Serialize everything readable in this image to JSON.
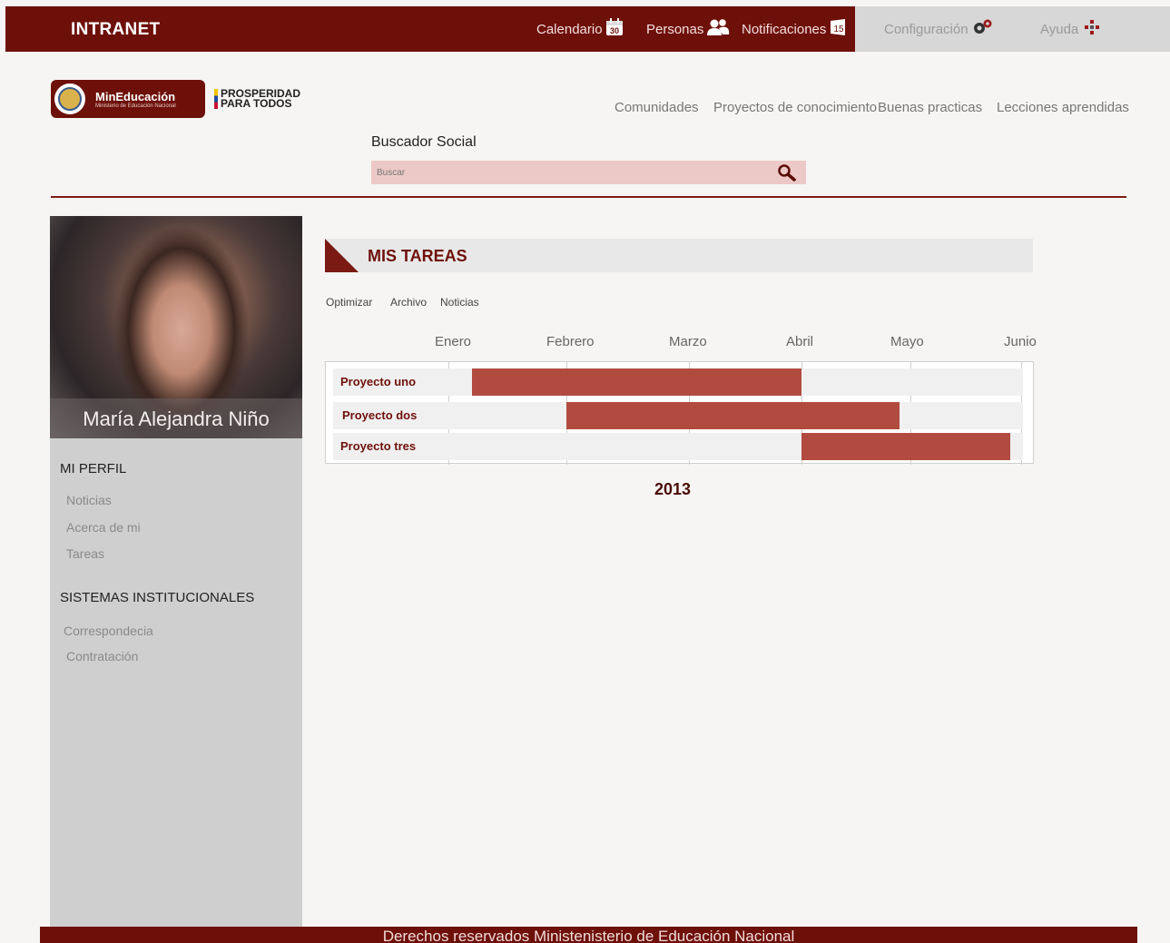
{
  "topbar": {
    "brand": "INTRANET",
    "calendario": "Calendario",
    "calendario_badge": "30",
    "personas": "Personas",
    "notificaciones": "Notificaciones",
    "notificaciones_badge": "15",
    "configuracion": "Configuración",
    "ayuda": "Ayuda"
  },
  "logo": {
    "name": "MinEducación",
    "subtitle": "Ministerio de Educación Nacional",
    "prosperidad_1": "PROSPERIDAD",
    "prosperidad_2": "PARA TODOS"
  },
  "nav": {
    "comunidades": "Comunidades",
    "proyectos": "Proyectos de conocimiento",
    "buenas": "Buenas practicas",
    "lecciones": "Lecciones aprendidas"
  },
  "search": {
    "label": "Buscador Social",
    "placeholder": "Buscar"
  },
  "profile": {
    "name": "María Alejandra Niño"
  },
  "sidebar": {
    "mi_perfil": "MI PERFIL",
    "items": [
      "Noticias",
      "Acerca de mi",
      "Tareas"
    ],
    "sistemas": "SISTEMAS INSTITUCIONALES",
    "sys_items": [
      "Correspondecia",
      "Contratación"
    ]
  },
  "tasks": {
    "title": "MIS TAREAS",
    "tabs": [
      "Optimizar",
      "Archivo",
      "Noticias"
    ],
    "months": [
      "Enero",
      "Febrero",
      "Marzo",
      "Abril",
      "Mayo",
      "Junio"
    ],
    "year": "2013",
    "projects": [
      {
        "name": "Proyecto uno",
        "start": 0.2,
        "end": 3.0
      },
      {
        "name": "Proyecto dos",
        "start": 1.0,
        "end": 3.9
      },
      {
        "name": "Proyecto tres",
        "start": 3.0,
        "end": 4.9
      }
    ]
  },
  "footer": {
    "text": "Derechos reservados Ministenisterio de Educación Nacional"
  },
  "colors": {
    "brand": "#6e100a",
    "bar": "#b24b3f",
    "search_bg": "#ecc9c6"
  }
}
